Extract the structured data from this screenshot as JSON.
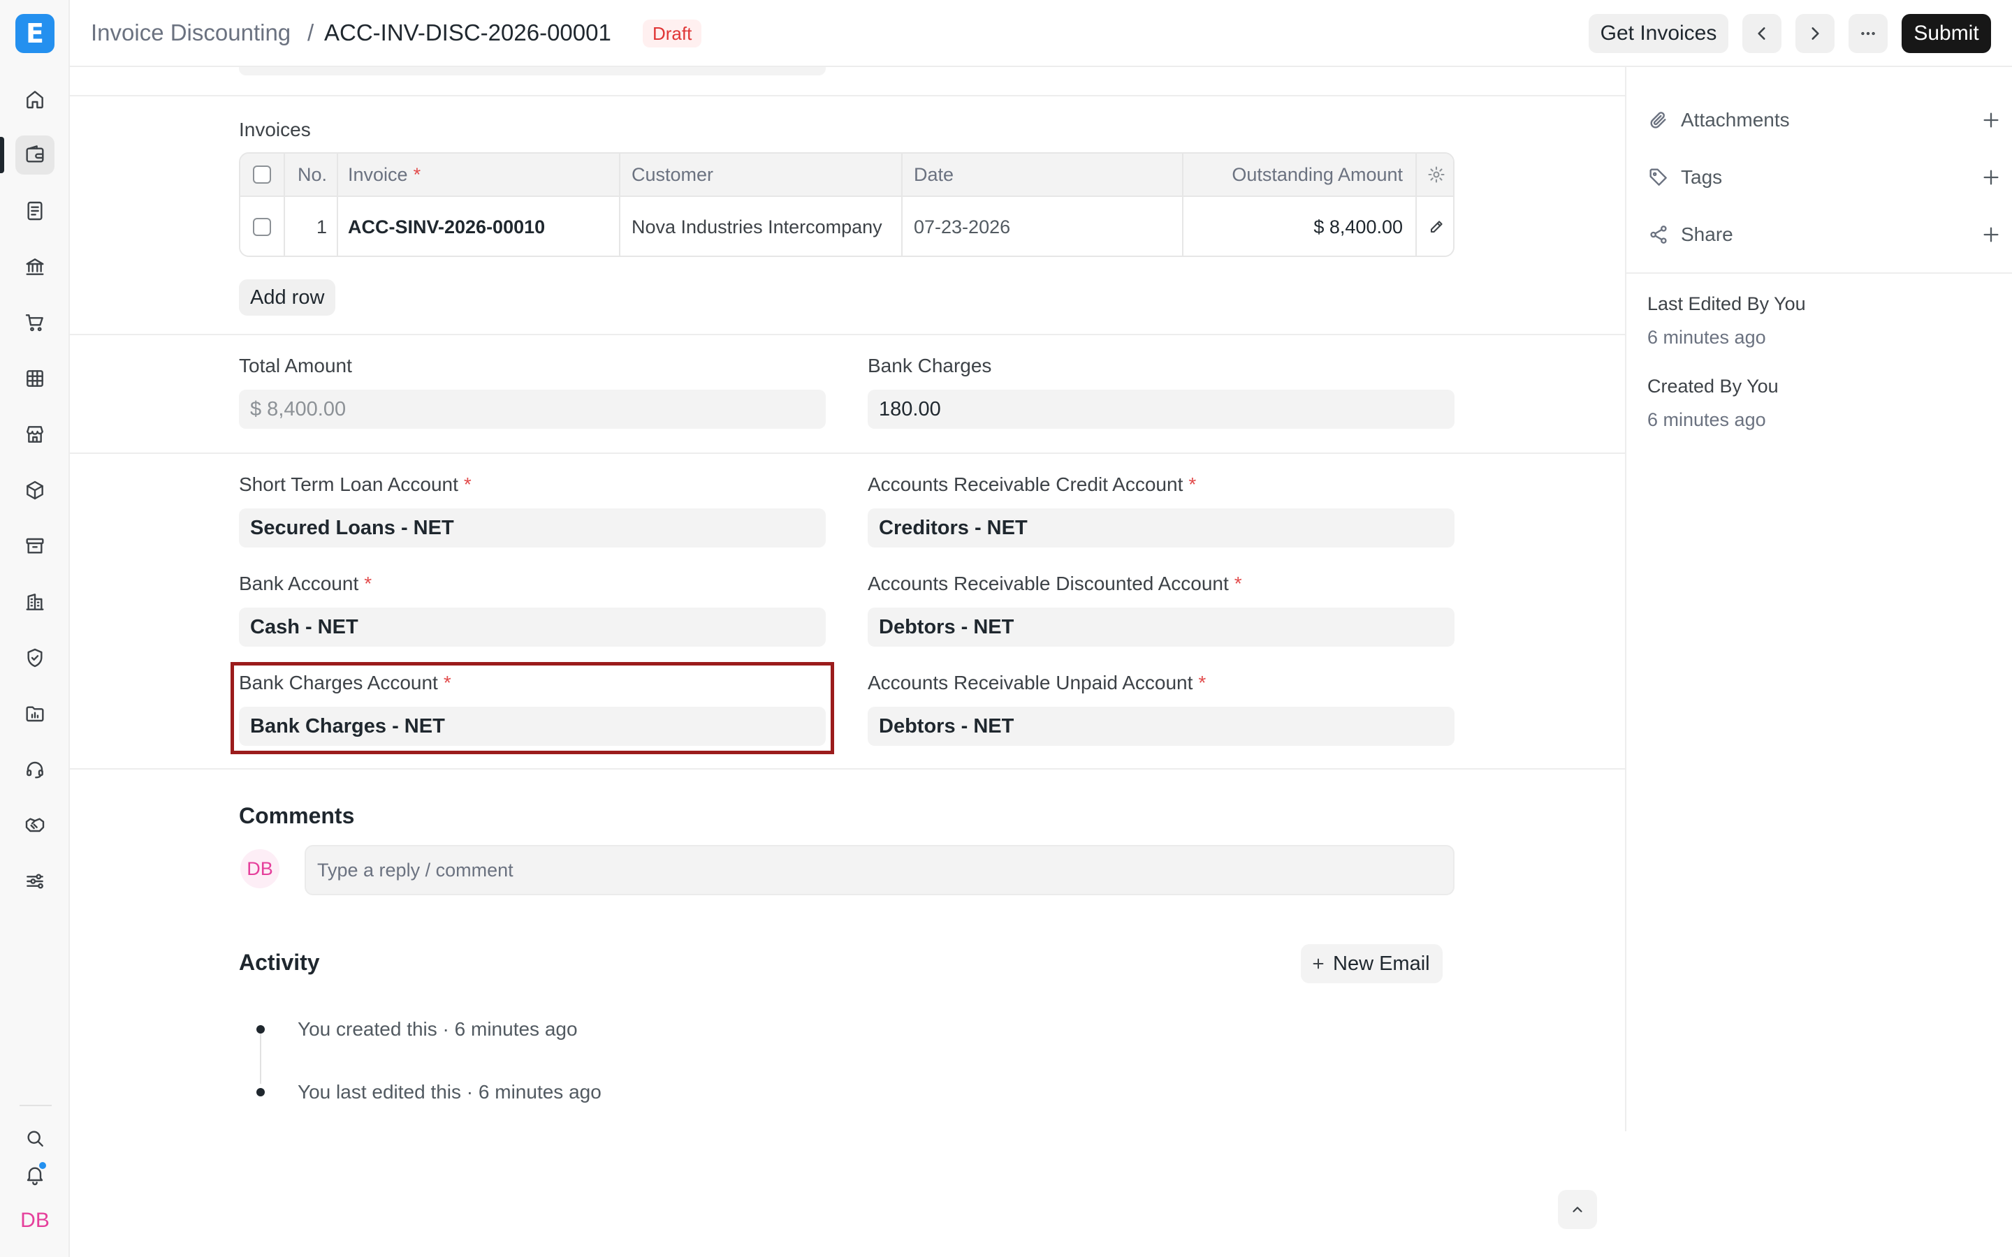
{
  "app": {
    "logo_letter": "E"
  },
  "header": {
    "breadcrumb_parent": "Invoice Discounting",
    "breadcrumb_separator": "/",
    "doc_title": "ACC-INV-DISC-2026-00001",
    "status": "Draft",
    "get_invoices_label": "Get Invoices",
    "submit_label": "Submit"
  },
  "invoices": {
    "label": "Invoices",
    "columns": {
      "no": "No.",
      "invoice": "Invoice",
      "customer": "Customer",
      "date": "Date",
      "outstanding": "Outstanding Amount"
    },
    "required_mark": "*",
    "rows": [
      {
        "no": "1",
        "invoice": "ACC-SINV-2026-00010",
        "customer": "Nova Industries Intercompany",
        "date": "07-23-2026",
        "outstanding": "$ 8,400.00"
      }
    ],
    "add_row_label": "Add row"
  },
  "amounts": {
    "total_amount_label": "Total Amount",
    "total_amount_value": "$ 8,400.00",
    "bank_charges_label": "Bank Charges",
    "bank_charges_value": "180.00"
  },
  "accounts": {
    "short_term_loan_label": "Short Term Loan Account",
    "short_term_loan_value": "Secured Loans - NET",
    "ar_credit_label": "Accounts Receivable Credit Account",
    "ar_credit_value": "Creditors - NET",
    "bank_account_label": "Bank Account",
    "bank_account_value": "Cash - NET",
    "ar_discounted_label": "Accounts Receivable Discounted Account",
    "ar_discounted_value": "Debtors - NET",
    "bank_charges_account_label": "Bank Charges Account",
    "bank_charges_account_value": "Bank Charges - NET",
    "ar_unpaid_label": "Accounts Receivable Unpaid Account",
    "ar_unpaid_value": "Debtors - NET"
  },
  "comments": {
    "heading": "Comments",
    "avatar_initials": "DB",
    "placeholder": "Type a reply / comment"
  },
  "activity": {
    "heading": "Activity",
    "new_email_label": "New Email",
    "items": [
      "You created this · 6 minutes ago",
      "You last edited this · 6 minutes ago"
    ]
  },
  "sidebar": {
    "attachments_label": "Attachments",
    "tags_label": "Tags",
    "share_label": "Share",
    "last_edited_by": "Last Edited By You",
    "last_edited_ago": "6 minutes ago",
    "created_by": "Created By You",
    "created_ago": "6 minutes ago"
  },
  "user": {
    "initials": "DB"
  },
  "colors": {
    "brand": "#2490ef",
    "draft_badge_bg": "#fff0f0",
    "draft_badge_text": "#e03636",
    "highlight_border": "#9b1c1c",
    "avatar_text": "#e53f9b"
  }
}
